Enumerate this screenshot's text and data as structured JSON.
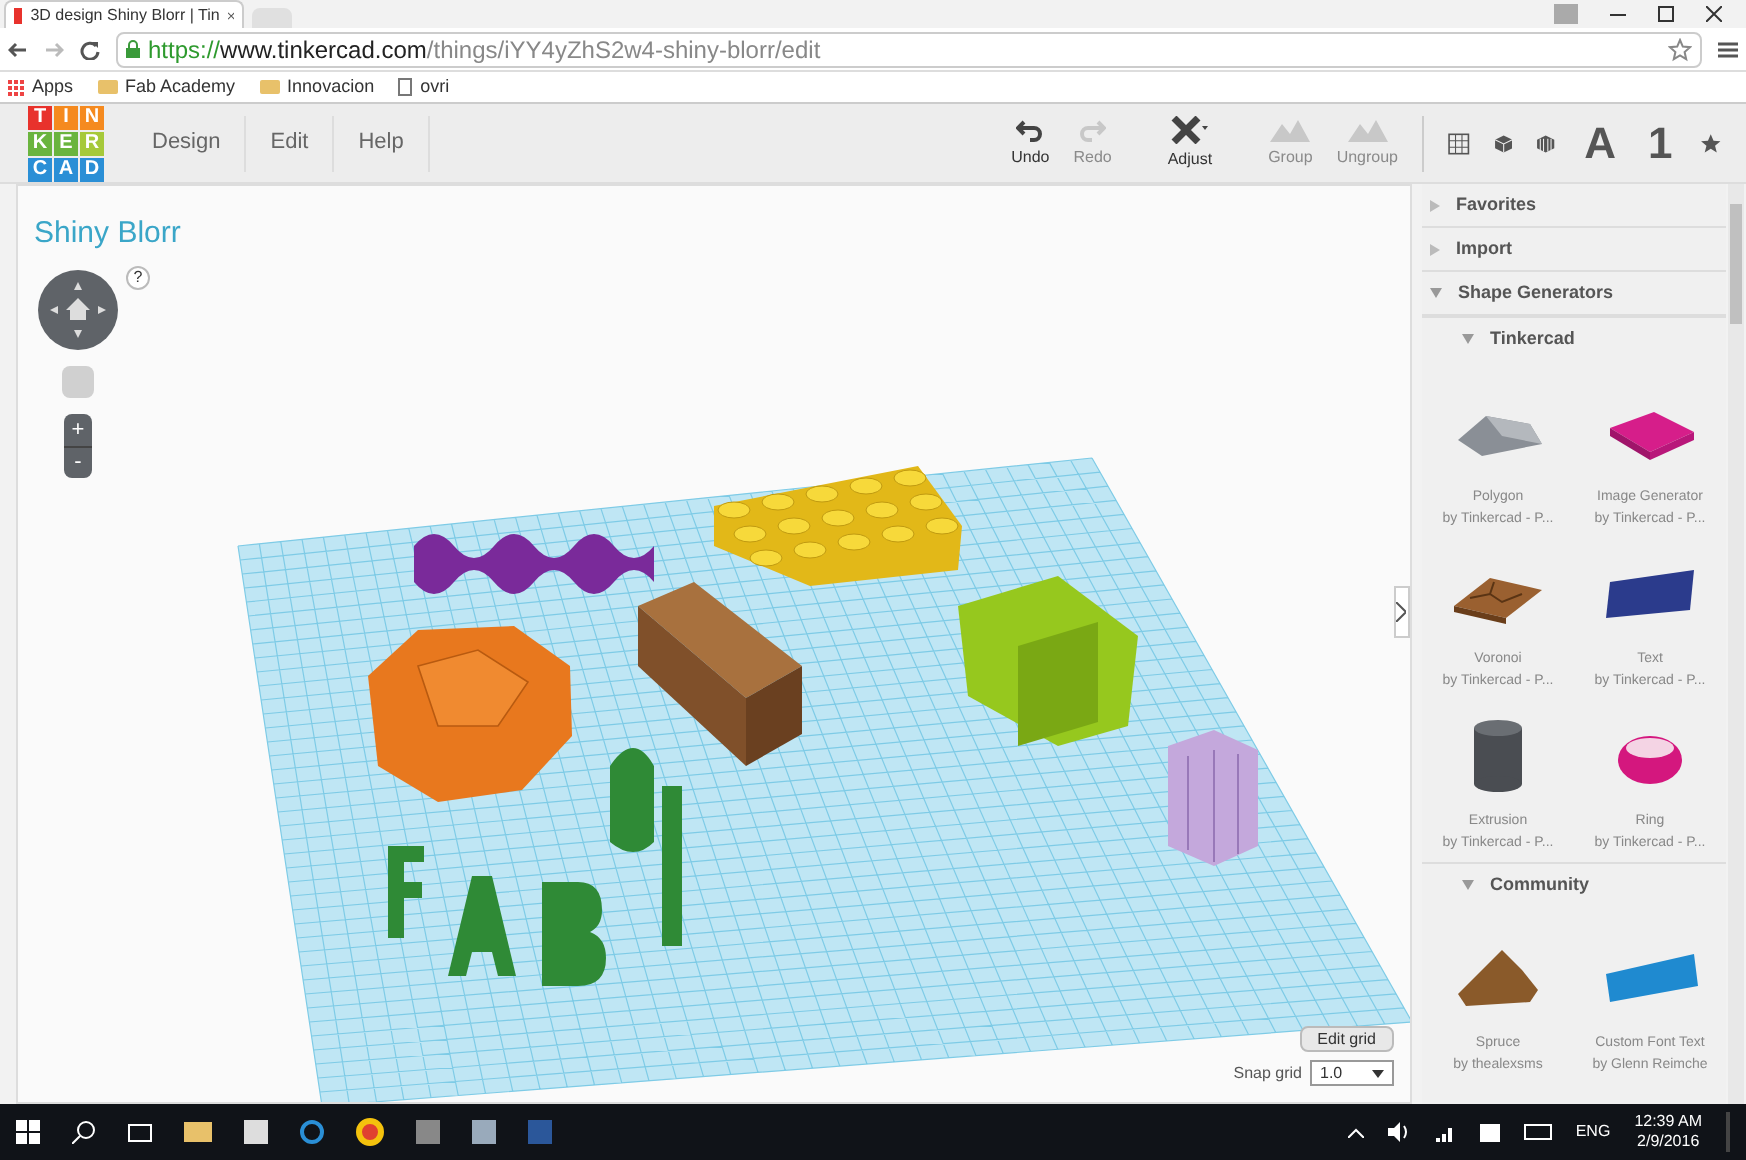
{
  "browser": {
    "tab_title": "3D design Shiny Blorr | Tin",
    "url_scheme": "https://",
    "url_host": "www.tinkercad.com",
    "url_path": "/things/iYY4yZhS2w4-shiny-blorr/edit",
    "bookmarks": [
      {
        "kind": "apps",
        "label": "Apps"
      },
      {
        "kind": "folder",
        "label": "Fab Academy"
      },
      {
        "kind": "folder",
        "label": "Innovacion"
      },
      {
        "kind": "page",
        "label": "ovri"
      }
    ]
  },
  "logo": [
    {
      "letter": "T",
      "color": "#e8322c"
    },
    {
      "letter": "I",
      "color": "#f58a1f"
    },
    {
      "letter": "N",
      "color": "#f58a1f"
    },
    {
      "letter": "K",
      "color": "#6ab43e"
    },
    {
      "letter": "E",
      "color": "#6ab43e"
    },
    {
      "letter": "R",
      "color": "#a6c93a"
    },
    {
      "letter": "C",
      "color": "#2a8fd6"
    },
    {
      "letter": "A",
      "color": "#2a8fd6"
    },
    {
      "letter": "D",
      "color": "#2a8fd6"
    }
  ],
  "menu": [
    "Design",
    "Edit",
    "Help"
  ],
  "toolbar": [
    {
      "kind": "undo",
      "label": "Undo",
      "disabled": false
    },
    {
      "kind": "redo",
      "label": "Redo",
      "disabled": true
    },
    {
      "kind": "adjust",
      "label": "Adjust",
      "disabled": false
    },
    {
      "kind": "group",
      "label": "Group",
      "disabled": true
    },
    {
      "kind": "ungroup",
      "label": "Ungroup",
      "disabled": true
    }
  ],
  "panel_tabs": [
    {
      "kind": "grid"
    },
    {
      "kind": "cube"
    },
    {
      "kind": "striped"
    },
    {
      "kind": "text",
      "label": "A"
    },
    {
      "kind": "text",
      "label": "1"
    },
    {
      "kind": "star"
    }
  ],
  "design_title": "Shiny Blorr",
  "help_label": "?",
  "zoom": {
    "in": "+",
    "out": "-"
  },
  "workplane": {
    "edit_grid": "Edit grid",
    "snap_label": "Snap grid",
    "snap_value": "1.0"
  },
  "sidebar": {
    "sections": [
      {
        "label": "Favorites",
        "expanded": false
      },
      {
        "label": "Import",
        "expanded": false
      },
      {
        "label": "Shape Generators",
        "expanded": true,
        "groups": [
          {
            "label": "Tinkercad",
            "expanded": true,
            "items": [
              {
                "kind": "polygon",
                "name": "Polygon",
                "author": "by Tinkercad - P..."
              },
              {
                "kind": "plate",
                "name": "Image Generator",
                "author": "by Tinkercad - P..."
              },
              {
                "kind": "voronoi",
                "name": "Voronoi",
                "author": "by Tinkercad - P..."
              },
              {
                "kind": "text3d",
                "name": "Text",
                "author": "by Tinkercad - P..."
              },
              {
                "kind": "cylinder",
                "name": "Extrusion",
                "author": "by Tinkercad - P..."
              },
              {
                "kind": "ring",
                "name": "Ring",
                "author": "by Tinkercad - P..."
              }
            ]
          },
          {
            "label": "Community",
            "expanded": true,
            "items": [
              {
                "kind": "spruce",
                "name": "Spruce",
                "author": "by thealexsms"
              },
              {
                "kind": "fonttext",
                "name": "Custom Font Text",
                "author": "by Glenn Reimche"
              }
            ]
          }
        ]
      }
    ]
  },
  "taskbar": {
    "language": "ENG",
    "time": "12:39 AM",
    "date": "2/9/2016"
  }
}
